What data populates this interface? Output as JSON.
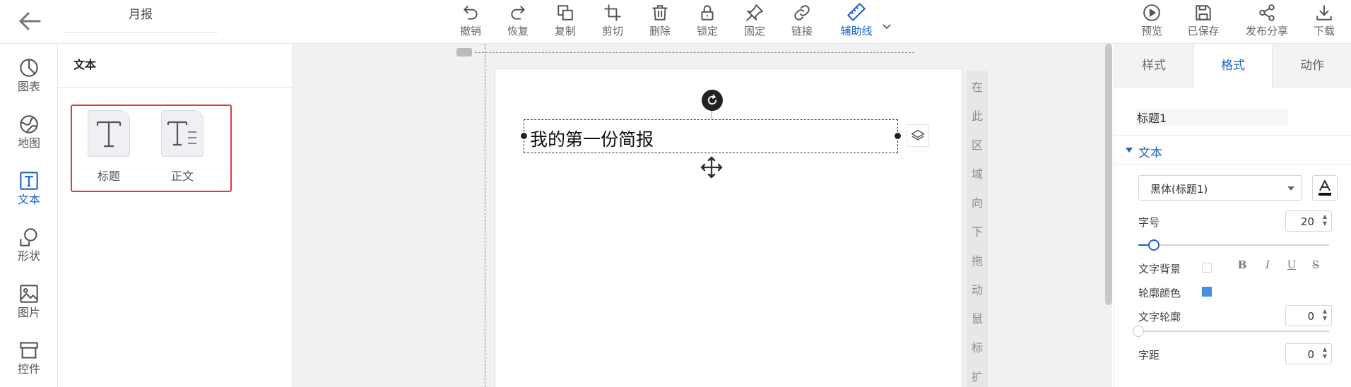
{
  "header": {
    "doc_title": "月报",
    "toolbar": [
      {
        "key": "undo",
        "label": "撤销",
        "icon": "undo-icon"
      },
      {
        "key": "redo",
        "label": "恢复",
        "icon": "redo-icon"
      },
      {
        "key": "copy",
        "label": "复制",
        "icon": "copy-icon"
      },
      {
        "key": "crop",
        "label": "剪切",
        "icon": "crop-icon"
      },
      {
        "key": "delete",
        "label": "删除",
        "icon": "trash-icon"
      },
      {
        "key": "lock",
        "label": "锁定",
        "icon": "lock-icon"
      },
      {
        "key": "pin",
        "label": "固定",
        "icon": "pin-icon"
      },
      {
        "key": "link",
        "label": "链接",
        "icon": "link-icon"
      },
      {
        "key": "guides",
        "label": "辅助线",
        "icon": "ruler-icon",
        "active": true
      }
    ],
    "actions": [
      {
        "key": "preview",
        "label": "预览",
        "icon": "play-icon"
      },
      {
        "key": "saved",
        "label": "已保存",
        "icon": "save-icon"
      },
      {
        "key": "share",
        "label": "发布分享",
        "icon": "share-icon"
      },
      {
        "key": "download",
        "label": "下载",
        "icon": "download-icon"
      }
    ]
  },
  "sidebar": {
    "items": [
      {
        "label": "图表",
        "icon": "chart-pie-icon"
      },
      {
        "label": "地图",
        "icon": "map-globe-icon"
      },
      {
        "label": "文本",
        "icon": "text-icon",
        "active": true
      },
      {
        "label": "形状",
        "icon": "shape-icon"
      },
      {
        "label": "图片",
        "icon": "image-icon"
      },
      {
        "label": "控件",
        "icon": "widget-icon"
      }
    ]
  },
  "panel": {
    "title": "文本",
    "components": [
      {
        "label": "标题",
        "icon": "title-text-icon"
      },
      {
        "label": "正文",
        "icon": "body-text-icon"
      }
    ]
  },
  "canvas": {
    "text_content": "我的第一份简报",
    "hint_chars": [
      "在",
      "此",
      "区",
      "域",
      "向",
      "下",
      "拖",
      "动",
      "鼠",
      "标",
      "扩"
    ]
  },
  "properties": {
    "tabs": [
      {
        "label": "样式"
      },
      {
        "label": "格式",
        "active": true
      },
      {
        "label": "动作"
      }
    ],
    "element_name": "标题1",
    "section_title": "文本",
    "font_family": "黑体(标题1)",
    "font_size_label": "字号",
    "font_size": "20",
    "font_size_level": 0.08,
    "text_bg_label": "文字背景",
    "format_buttons": [
      "B",
      "I",
      "U",
      "S"
    ],
    "outline_color_label": "轮廓颜色",
    "outline_color": "#4a90e2",
    "text_outline_label": "文字轮廓",
    "text_outline": "0",
    "text_outline_level": 0,
    "letter_spacing_label": "字距",
    "letter_spacing": "0"
  },
  "colors": {
    "accent": "#1e64c8",
    "selection_box": "#e53935"
  }
}
